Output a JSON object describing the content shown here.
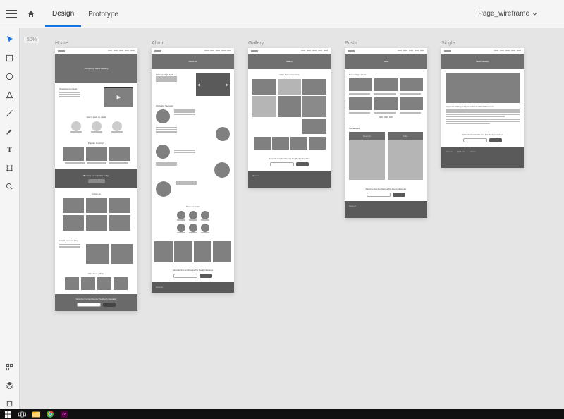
{
  "topbar": {
    "tabs": {
      "design": "Design",
      "prototype": "Prototype"
    },
    "docname": "Page_wireframe"
  },
  "zoom": "50%",
  "artboards": {
    "home": {
      "label": "Home",
      "hero_t": "Everything Starts Healthy",
      "s1": "Organize your best",
      "s2": "How it work on detail",
      "band": "Become our member today",
      "s3": "Popular inventory",
      "s4": "Follow us",
      "s5": "Latest from our blog",
      "s6": "Click from gallery",
      "sub": "Subscribe Now And Receive The Weekly Newsletter"
    },
    "about": {
      "label": "About",
      "hero_t": "About us",
      "s1": "What we fight for?",
      "s2": "Workflow / session",
      "s3": "Meet our team",
      "sub": "Subscribe Now And Receive The Weekly Newsletter",
      "foot": "About us"
    },
    "gallery": {
      "label": "Gallery",
      "hero_t": "Gallery",
      "s1": "Click from times here",
      "sub": "Subscribe Now And Receive The Weekly Newsletter",
      "foot": "About us"
    },
    "posts": {
      "label": "Posts",
      "hero_t": "News",
      "s1": "Something's New!",
      "s2": "Social feed",
      "fb": "Facebook",
      "tw": "Twitter",
      "sub": "Subscribe Now And Receive The Weekly Newsletter",
      "foot": "About us"
    },
    "single": {
      "label": "Single",
      "hero_t": "News Healthy",
      "body": "Copy From Training Ready! Good For Your Health? Here's the…",
      "sub": "Subscribe Now And Receive The Weekly Newsletter",
      "foot": "About us",
      "quick": "Quick links",
      "contact": "Contact"
    }
  }
}
